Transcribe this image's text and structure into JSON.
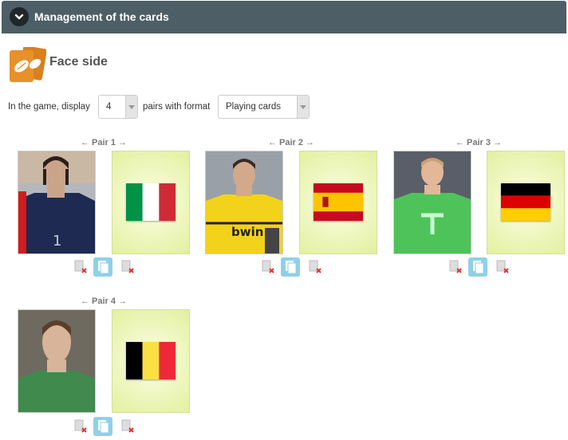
{
  "panel": {
    "title": "Management of the cards"
  },
  "face_side": {
    "title": "Face side"
  },
  "controls": {
    "prefix": "In the game, display",
    "pairs_count": "4",
    "middle": "pairs with format",
    "format": "Playing cards"
  },
  "pairs": [
    {
      "label": "← Pair 1 →",
      "player": "Goalkeeper in dark navy jersey number 1",
      "flag": "Italy"
    },
    {
      "label": "← Pair 2 →",
      "player": "Goalkeeper in yellow bwin jersey",
      "flag": "Spain"
    },
    {
      "label": "← Pair 3 →",
      "player": "Goalkeeper in green T-jersey",
      "flag": "Germany"
    },
    {
      "label": "← Pair 4 →",
      "player": "Goalkeeper in green jersey",
      "flag": "Belgium"
    }
  ],
  "colors": {
    "header_bg": "#4d5e66",
    "accent_orange": "#e8902a",
    "active_blue": "#8fd0e8"
  }
}
